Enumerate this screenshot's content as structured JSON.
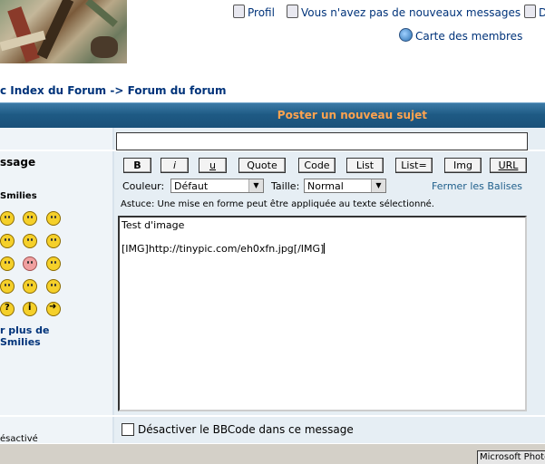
{
  "header": {
    "links": {
      "profil": "Profil",
      "messages": "Vous n'avez pas de nouveaux messages",
      "cut": "D",
      "carte": "Carte des membres"
    }
  },
  "breadcrumb": {
    "index": "c Index du Forum",
    "sep": "->",
    "forum": "Forum du forum"
  },
  "page_title": "Poster un nouveau sujet",
  "form": {
    "message_label": "ssage",
    "smilies_label": "Smilies",
    "more_smilies": [
      "r plus de",
      "Smilies"
    ],
    "subject_value": "",
    "bbcode_buttons": [
      "B",
      "i",
      "u",
      "Quote",
      "Code",
      "List",
      "List=",
      "Img",
      "URL"
    ],
    "couleur_label": "Couleur:",
    "couleur_value": "Défaut",
    "taille_label": "Taille:",
    "taille_value": "Normal",
    "close_tags": "Fermer les Balises",
    "hint": "Astuce: Une mise en forme peut être appliquée au texte sélectionné.",
    "message_lines": [
      "Test d'image",
      "[IMG]http://tinypic.com/eh0xfn.jpg[/IMG]"
    ],
    "disable_bbcode": "Désactiver le BBCode dans ce message",
    "left_status": "ésactivé"
  },
  "taskbar": {
    "item": "Microsoft Photo"
  }
}
